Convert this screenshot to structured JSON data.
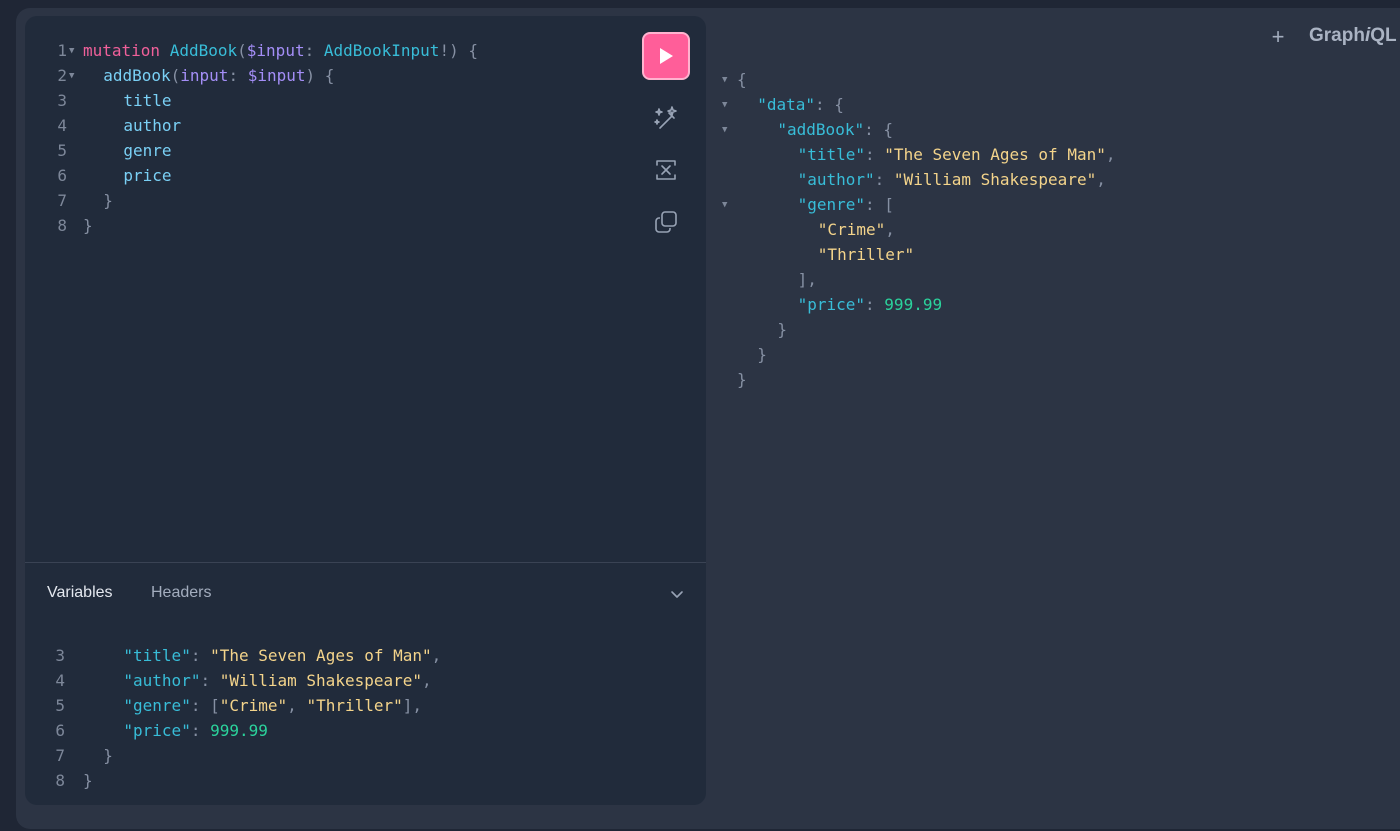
{
  "toolbar": {
    "run_icon": "play-icon",
    "prettify_icon": "magic-wand-icon",
    "merge_icon": "merge-fragments-icon",
    "copy_icon": "copy-icon"
  },
  "query_editor": {
    "lines": [
      {
        "num": "1",
        "fold": true,
        "indent": 0,
        "tokens": [
          {
            "t": "mutation",
            "c": "kw"
          },
          {
            "t": " "
          },
          {
            "t": "AddBook",
            "c": "def"
          },
          {
            "t": "(",
            "c": "punct"
          },
          {
            "t": "$input",
            "c": "var"
          },
          {
            "t": ": ",
            "c": "punct"
          },
          {
            "t": "AddBookInput",
            "c": "type"
          },
          {
            "t": "!) {",
            "c": "punct"
          }
        ]
      },
      {
        "num": "2",
        "fold": true,
        "indent": 1,
        "tokens": [
          {
            "t": "addBook",
            "c": "field"
          },
          {
            "t": "(",
            "c": "punct"
          },
          {
            "t": "input",
            "c": "var"
          },
          {
            "t": ": ",
            "c": "punct"
          },
          {
            "t": "$input",
            "c": "var"
          },
          {
            "t": ") {",
            "c": "punct"
          }
        ]
      },
      {
        "num": "3",
        "fold": false,
        "indent": 2,
        "tokens": [
          {
            "t": "title",
            "c": "field"
          }
        ]
      },
      {
        "num": "4",
        "fold": false,
        "indent": 2,
        "tokens": [
          {
            "t": "author",
            "c": "field"
          }
        ]
      },
      {
        "num": "5",
        "fold": false,
        "indent": 2,
        "tokens": [
          {
            "t": "genre",
            "c": "field"
          }
        ]
      },
      {
        "num": "6",
        "fold": false,
        "indent": 2,
        "tokens": [
          {
            "t": "price",
            "c": "field"
          }
        ]
      },
      {
        "num": "7",
        "fold": false,
        "indent": 1,
        "tokens": [
          {
            "t": "}",
            "c": "punct"
          }
        ]
      },
      {
        "num": "8",
        "fold": false,
        "indent": 0,
        "tokens": [
          {
            "t": "}",
            "c": "punct"
          }
        ]
      }
    ]
  },
  "tabs": {
    "variables": "Variables",
    "headers": "Headers",
    "toggle_icon": "chevron-down-icon"
  },
  "variables_editor": {
    "lines": [
      {
        "num": "3",
        "indent": 2,
        "tokens": [
          {
            "t": "\"title\"",
            "c": "key"
          },
          {
            "t": ": ",
            "c": "punct"
          },
          {
            "t": "\"The Seven Ages of Man\"",
            "c": "str"
          },
          {
            "t": ",",
            "c": "punct"
          }
        ]
      },
      {
        "num": "4",
        "indent": 2,
        "tokens": [
          {
            "t": "\"author\"",
            "c": "key"
          },
          {
            "t": ": ",
            "c": "punct"
          },
          {
            "t": "\"William Shakespeare\"",
            "c": "str"
          },
          {
            "t": ",",
            "c": "punct"
          }
        ]
      },
      {
        "num": "5",
        "indent": 2,
        "tokens": [
          {
            "t": "\"genre\"",
            "c": "key"
          },
          {
            "t": ": [",
            "c": "punct"
          },
          {
            "t": "\"Crime\"",
            "c": "str"
          },
          {
            "t": ", ",
            "c": "punct"
          },
          {
            "t": "\"Thriller\"",
            "c": "str"
          },
          {
            "t": "],",
            "c": "punct"
          }
        ]
      },
      {
        "num": "6",
        "indent": 2,
        "tokens": [
          {
            "t": "\"price\"",
            "c": "key"
          },
          {
            "t": ": ",
            "c": "punct"
          },
          {
            "t": "999.99",
            "c": "num"
          }
        ]
      },
      {
        "num": "7",
        "indent": 1,
        "tokens": [
          {
            "t": "}",
            "c": "punct"
          }
        ]
      },
      {
        "num": "8",
        "indent": 0,
        "tokens": [
          {
            "t": "}",
            "c": "punct"
          }
        ]
      }
    ]
  },
  "response_viewer": {
    "lines": [
      {
        "fold": true,
        "indent": 0,
        "tokens": [
          {
            "t": "{",
            "c": "punct"
          }
        ]
      },
      {
        "fold": true,
        "indent": 1,
        "tokens": [
          {
            "t": "\"data\"",
            "c": "key"
          },
          {
            "t": ": {",
            "c": "punct"
          }
        ]
      },
      {
        "fold": true,
        "indent": 2,
        "tokens": [
          {
            "t": "\"addBook\"",
            "c": "key"
          },
          {
            "t": ": {",
            "c": "punct"
          }
        ]
      },
      {
        "fold": false,
        "indent": 3,
        "tokens": [
          {
            "t": "\"title\"",
            "c": "key"
          },
          {
            "t": ": ",
            "c": "punct"
          },
          {
            "t": "\"The Seven Ages of Man\"",
            "c": "str"
          },
          {
            "t": ",",
            "c": "punct"
          }
        ]
      },
      {
        "fold": false,
        "indent": 3,
        "tokens": [
          {
            "t": "\"author\"",
            "c": "key"
          },
          {
            "t": ": ",
            "c": "punct"
          },
          {
            "t": "\"William Shakespeare\"",
            "c": "str"
          },
          {
            "t": ",",
            "c": "punct"
          }
        ]
      },
      {
        "fold": true,
        "indent": 3,
        "tokens": [
          {
            "t": "\"genre\"",
            "c": "key"
          },
          {
            "t": ": [",
            "c": "punct"
          }
        ]
      },
      {
        "fold": false,
        "indent": 4,
        "tokens": [
          {
            "t": "\"Crime\"",
            "c": "str"
          },
          {
            "t": ",",
            "c": "punct"
          }
        ]
      },
      {
        "fold": false,
        "indent": 4,
        "tokens": [
          {
            "t": "\"Thriller\"",
            "c": "str"
          }
        ]
      },
      {
        "fold": false,
        "indent": 3,
        "tokens": [
          {
            "t": "],",
            "c": "punct"
          }
        ]
      },
      {
        "fold": false,
        "indent": 3,
        "tokens": [
          {
            "t": "\"price\"",
            "c": "key"
          },
          {
            "t": ": ",
            "c": "punct"
          },
          {
            "t": "999.99",
            "c": "num"
          }
        ]
      },
      {
        "fold": false,
        "indent": 2,
        "tokens": [
          {
            "t": "}",
            "c": "punct"
          }
        ]
      },
      {
        "fold": false,
        "indent": 1,
        "tokens": [
          {
            "t": "}",
            "c": "punct"
          }
        ]
      },
      {
        "fold": false,
        "indent": 0,
        "tokens": [
          {
            "t": "}",
            "c": "punct"
          }
        ]
      }
    ]
  },
  "header": {
    "new_tab_label": "+",
    "logo_prefix": "Graph",
    "logo_italic": "i",
    "logo_suffix": "QL"
  },
  "colors": {
    "accent": "#ff5e99",
    "background": "#2c3444",
    "editor_background": "#212b3b"
  }
}
